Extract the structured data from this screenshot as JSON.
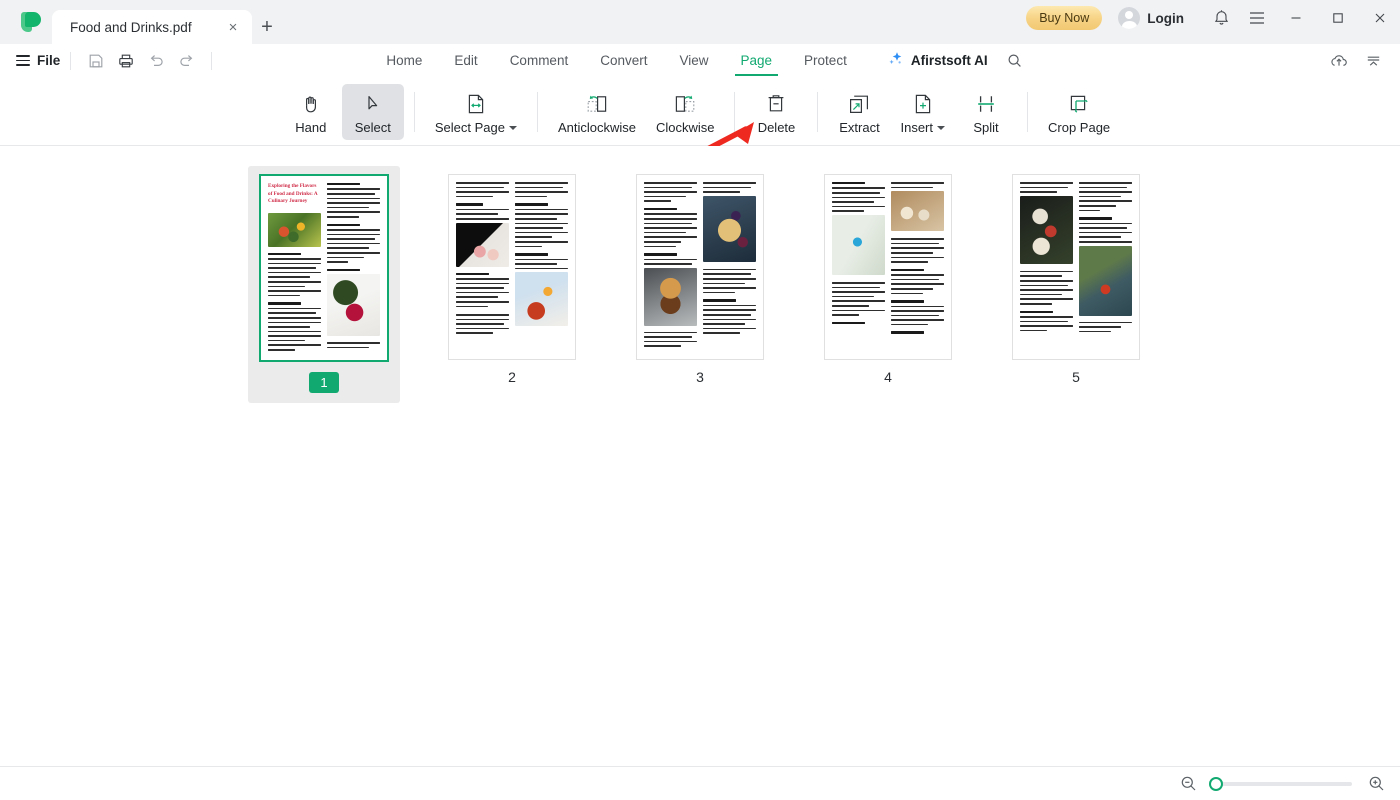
{
  "window": {
    "tab_title": "Food and Drinks.pdf",
    "close_tab_glyph": "×",
    "new_tab_glyph": "+",
    "minimize_glyph": "—",
    "maximize_glyph": "□",
    "close_glyph": "×"
  },
  "titlebar": {
    "buy_now": "Buy Now",
    "login": "Login",
    "accent_green": "#12a971",
    "buy_now_color": "#f2c871"
  },
  "menubar": {
    "file": "File",
    "items": [
      {
        "label": "Home",
        "active": false
      },
      {
        "label": "Edit",
        "active": false
      },
      {
        "label": "Comment",
        "active": false
      },
      {
        "label": "Convert",
        "active": false
      },
      {
        "label": "View",
        "active": false
      },
      {
        "label": "Page",
        "active": true
      },
      {
        "label": "Protect",
        "active": false
      }
    ],
    "ai_label": "Afirstsoft AI"
  },
  "ribbon": {
    "tools": [
      {
        "label": "Hand",
        "icon": "hand-icon",
        "selected": false,
        "has_caret": false
      },
      {
        "label": "Select",
        "icon": "cursor-icon",
        "selected": true,
        "has_caret": false
      },
      {
        "label": "Select Page",
        "icon": "select-page-icon",
        "selected": false,
        "has_caret": true
      },
      {
        "label": "Anticlockwise",
        "icon": "rotate-left-icon",
        "selected": false,
        "has_caret": false
      },
      {
        "label": "Clockwise",
        "icon": "rotate-right-icon",
        "selected": false,
        "has_caret": false
      },
      {
        "label": "Delete",
        "icon": "trash-icon",
        "selected": false,
        "has_caret": false
      },
      {
        "label": "Extract",
        "icon": "extract-icon",
        "selected": false,
        "has_caret": false
      },
      {
        "label": "Insert",
        "icon": "insert-page-icon",
        "selected": false,
        "has_caret": true
      },
      {
        "label": "Split",
        "icon": "split-icon",
        "selected": false,
        "has_caret": false
      },
      {
        "label": "Crop Page",
        "icon": "crop-icon",
        "selected": false,
        "has_caret": false
      }
    ],
    "highlight": {
      "target": "Delete",
      "color": "#ef2b2b"
    },
    "annotation_arrow": {
      "color": "#ee2a20",
      "points_to": "Delete"
    }
  },
  "pages": [
    {
      "number": "1",
      "selected": true,
      "heading": "Exploring the\nFlavors of Food\nand Drinks: A\nCulinary Journey"
    },
    {
      "number": "2",
      "selected": false,
      "heading": ""
    },
    {
      "number": "3",
      "selected": false,
      "heading": ""
    },
    {
      "number": "4",
      "selected": false,
      "heading": ""
    },
    {
      "number": "5",
      "selected": false,
      "heading": ""
    }
  ],
  "bottombar": {
    "zoom_out": "zoom-out-icon",
    "zoom_in": "zoom-in-icon",
    "zoom_value": 0
  }
}
